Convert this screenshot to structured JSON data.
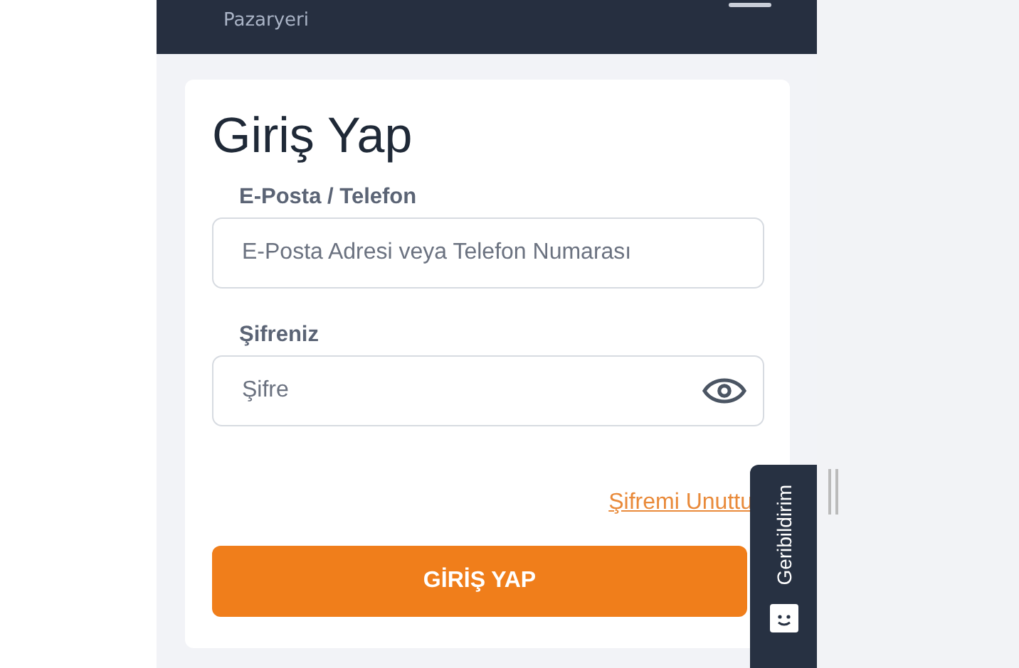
{
  "header": {
    "subtitle": "Pazaryeri"
  },
  "login": {
    "title": "Giriş Yap",
    "fields": [
      {
        "label": "E-Posta / Telefon",
        "placeholder": "E-Posta Adresi veya Telefon Numarası",
        "kind": "text"
      },
      {
        "label": "Şifreniz",
        "placeholder": "Şifre",
        "kind": "password"
      }
    ],
    "forgot_link": "Şifremi Unuttu",
    "submit": "GİRİŞ YAP"
  },
  "feedback_tab": {
    "label": "Geribildirim"
  }
}
